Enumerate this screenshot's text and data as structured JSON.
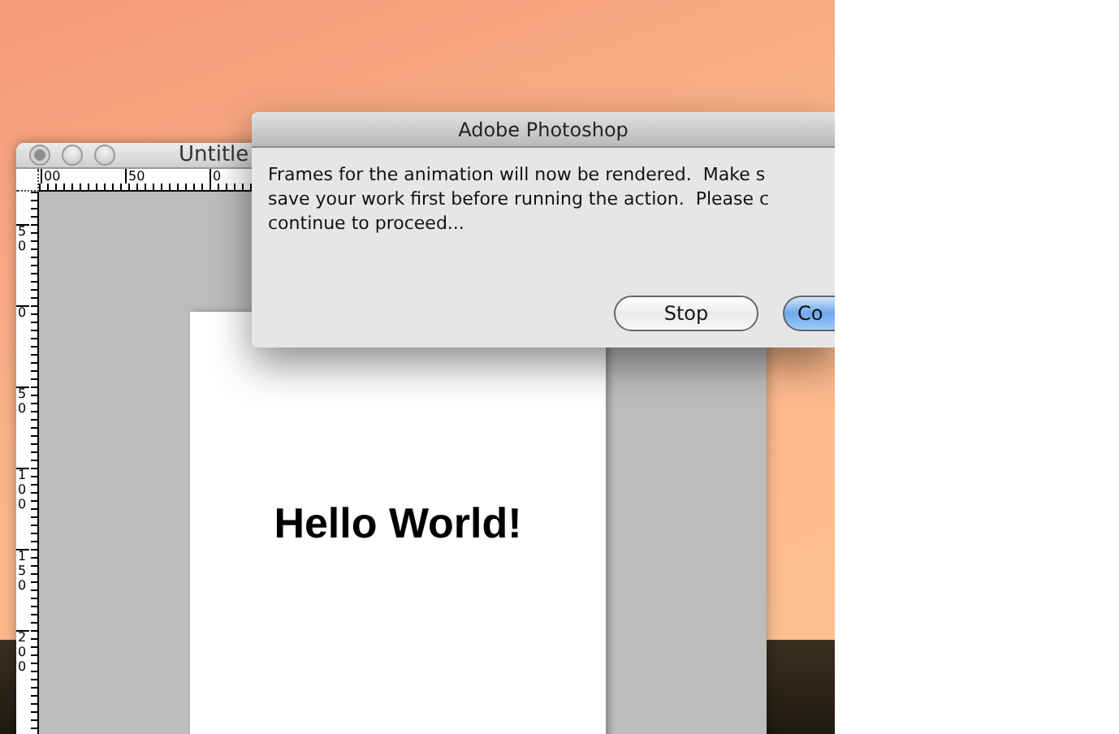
{
  "document_window": {
    "title": "Untitle",
    "traffic_lights": [
      {
        "kind": "close"
      },
      {
        "kind": "minimize"
      },
      {
        "kind": "zoom"
      }
    ],
    "horizontal_ruler": [
      "00",
      "50",
      "0"
    ],
    "vertical_ruler": [
      "50",
      "0",
      "50",
      "100",
      "150",
      "200"
    ],
    "canvas_text": "Hello World!"
  },
  "dialog": {
    "title": "Adobe Photoshop",
    "message": [
      "Frames for the animation will now be rendered.  Make s",
      "save your work first before running the action.  Please c",
      "continue to proceed..."
    ],
    "buttons": [
      {
        "label": "Stop",
        "default": false
      },
      {
        "label": "Co",
        "default": true
      }
    ]
  }
}
